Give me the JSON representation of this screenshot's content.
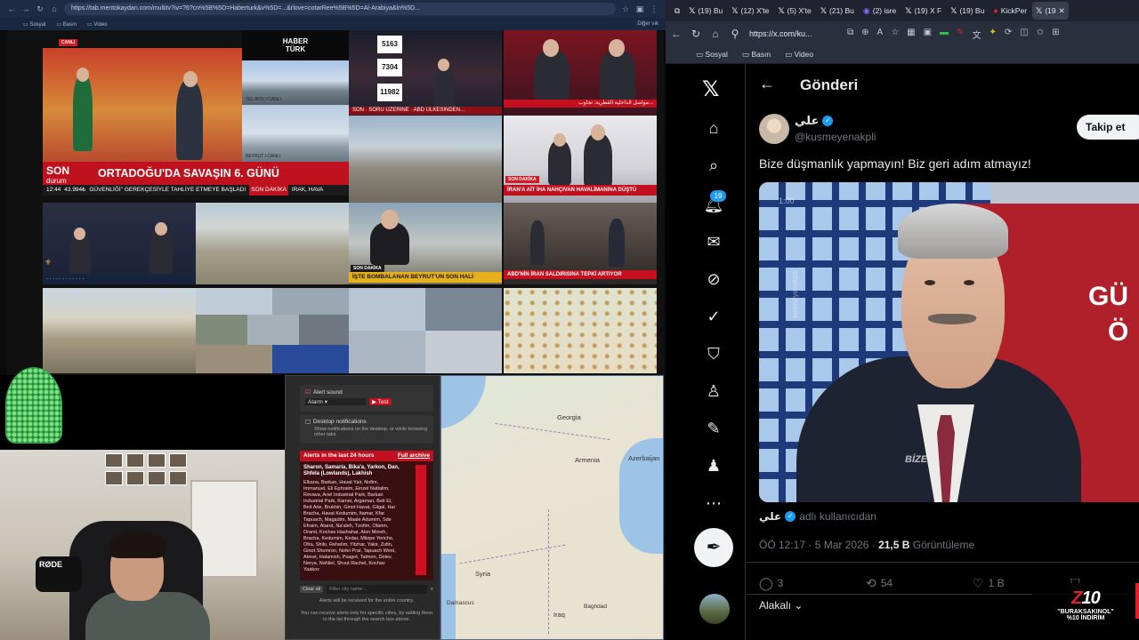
{
  "left_browser": {
    "url": "https://tab.mentokaydan.com/multitv?iv=?6?cn%5B%5D=Haberturk&v%5D=...&rlove=cotarRee%5B%5D=Al-Arabiya&ln%5D...",
    "bookmarks": [
      "Sosyal",
      "Basın",
      "Video"
    ],
    "bookmark_right": "Diğer sık"
  },
  "news_wall": {
    "live_label": "CANLI",
    "channel_logo": "HABER\nTÜRK",
    "tel_aviv_label": "TEL AVIV / CANLI",
    "beirut_label": "BEYRUT / CANLI",
    "son_durum_top": "SON",
    "son_durum_bottom": "durum",
    "main_headline": "ORTADOĞU'DA SAVAŞIN 6. GÜNÜ",
    "ticker_time": "12:44",
    "ticker_value": "43.994₺",
    "ticker_text": "GÜVENLİĞİ\" GEREKÇESİYLE TAHLİYE ETMEYE BAŞLADI",
    "ticker_tag": "SON DAKİKA",
    "ticker_tail": "IRAK, HAVA",
    "score_values": [
      "5163",
      "7304",
      "11982"
    ],
    "arabic_banner": "مواصل الداخلية القطرية: تجاوب...",
    "son_dakika_tag": "SON DAKİKA",
    "iran_headline": "İRAN'A AİT İHA NAHÇIVAN HAVALİMANINA DÜŞTÜ",
    "abd_headline": "ABD'NİN İRAN SALDIRISINA TEPKİ ARTIYOR",
    "beyrut_headline": "İŞTE BOMBALANAN BEYRUT'UN SON HALİ",
    "beyrut_tag": "SON DAKİKA"
  },
  "alerts_panel": {
    "alert_sound_label": "Alert sound",
    "alert_option": "Alarm",
    "test_button": "▶ Test",
    "desktop_notifications_title": "Desktop notifications",
    "desktop_notifications_desc": "Show notifications on the desktop, or while browsing other tabs",
    "alerts_header": "Alerts in the last 24 hours",
    "full_archive": "Full archive",
    "alert_title": "Sharon, Samaria, Bika'a, Yarkon, Dan, Shfela (Lowlands), Lakhish",
    "alert_body": "Elkana, Barkan, Havat Yair, Nofim, Immanuel, Eli Ephraim, Einzel Nattalim, Revava, Ariel Industrial Park, Barkan Industrial Park, Karnei, Argaman, Beit El, Beit Arie, Brukhin, Ginot Havat, Gilgal, Har Bracha, Havat Kedumim, Itamar, Kfar Tapuach, Magadim, Maale Adumim, Sde Efraim, Atarot, Na'aleh, Tzofim, Ofarim, Oranit, Kochav Hashahar, Alon Moreh, Bracha, Kedumim, Kedar, Mitzpe Yericho, Ofra, Shilo, Rehelim, Yitzhar, Yakir, Zufin, Ginot Shomron, Nofei Prat, Tapuach West, Ateret, Halamish, Psagot, Talmon, Dolev, Nerya, Nahliel, Shvut Rachel, Kochav Yaakov",
    "clear_all": "Clear all",
    "city_placeholder": "Filter city name...",
    "note1": "Alerts will be received for the entire country.",
    "note2": "You can receive alerts only for specific cities, by adding them to the list through the search box above."
  },
  "map_labels": {
    "georgia": "Georgia",
    "armenia": "Armenia",
    "azerbaijan": "Azerbaijan",
    "syria": "Syria",
    "damascus": "Damascus",
    "baghdad": "Baghdad",
    "iraq": "Iraq"
  },
  "right_browser": {
    "tabs": [
      {
        "label": "(19) Bu"
      },
      {
        "label": "(12) X'te"
      },
      {
        "label": "(5) X'te"
      },
      {
        "label": "(21) Bu"
      },
      {
        "label": "(2) isre"
      },
      {
        "label": "(19) X F"
      },
      {
        "label": "(19) Bu"
      },
      {
        "label": "KickPer"
      },
      {
        "label": "(19"
      }
    ],
    "url": "https://x.com/ku...",
    "bookmarks": [
      "Sosyal",
      "Basın",
      "Video"
    ]
  },
  "x_app": {
    "notification_count": "19",
    "header_title": "Gönderi",
    "author_name": "علي",
    "author_handle": "@kusmeyenakpli",
    "follow_button": "Takip et",
    "tweet_text": "Bize düşmanlık yapmayın! Biz geri adım atmayız!",
    "video_time": "1:00",
    "video_watermark": "kusmeyenakpli",
    "video_caption": "BİZE",
    "video_overlay_1": "GÜ",
    "video_overlay_2": "Ö",
    "via_name": "علي",
    "via_text": "adlı kullanıcıdan",
    "meta_time": "ÖÖ 12:17 · 5 Mar 2026 ·",
    "meta_views_count": "21,5 B",
    "meta_views_label": "Görüntüleme",
    "reply_count": "3",
    "repost_count": "54",
    "like_count": "1 B",
    "sort_label": "Alakalı"
  },
  "promo": {
    "brand_a": "Z",
    "brand_b": "10",
    "line1": "\"BURAKSAKINOL\"",
    "line2": "%10 İNDİRİM"
  },
  "colors": {
    "x_blue": "#1d9bf0",
    "news_red": "#c0111f",
    "x_bg": "#000000"
  }
}
